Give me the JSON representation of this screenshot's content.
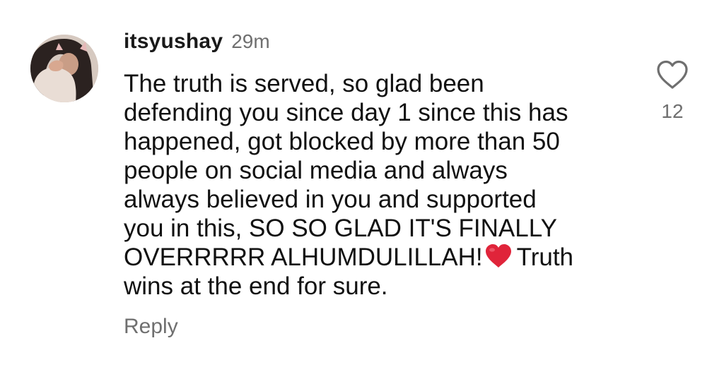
{
  "comment": {
    "username": "itsyushay",
    "timestamp": "29m",
    "text_lines": [
      "The truth is served, so glad been",
      "defending you since day 1 since this has",
      "happened, got blocked by more than 50",
      "people on social media and always",
      "always believed in you and supported",
      "you in this, SO SO GLAD IT'S FINALLY"
    ],
    "text_line_7_before_emoji": "OVERRRRR ALHUMDULILLAH!",
    "text_line_7_after_emoji": "Truth",
    "text_line_8": "wins at the end for sure.",
    "emoji": "red-heart-emoji",
    "reply_label": "Reply",
    "like_icon": "heart-outline-icon",
    "like_count": "12"
  },
  "colors": {
    "text_primary": "#111111",
    "text_secondary": "#6f6f6f",
    "heart_emoji": "#e0243a"
  }
}
